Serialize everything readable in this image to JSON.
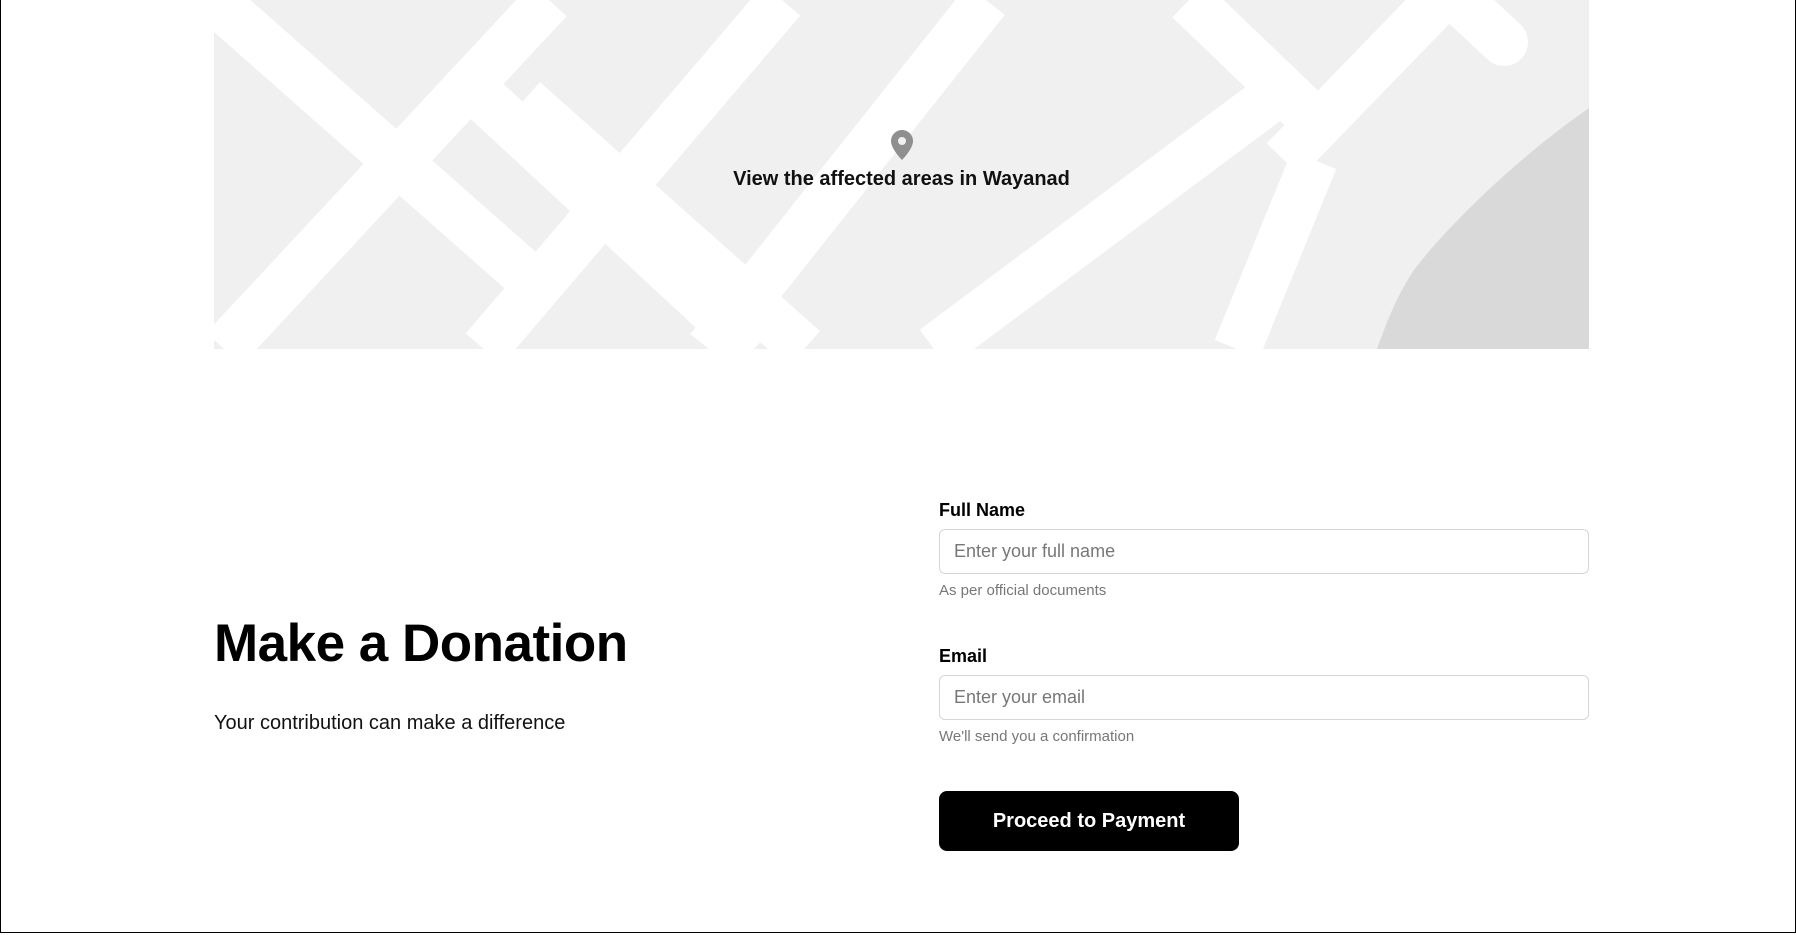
{
  "map": {
    "caption": "View the affected areas in Wayanad",
    "pin_icon": "map-pin-icon"
  },
  "donation": {
    "title": "Make a Donation",
    "subtitle": "Your contribution can make a difference"
  },
  "form": {
    "full_name": {
      "label": "Full Name",
      "placeholder": "Enter your full name",
      "hint": "As per official documents"
    },
    "email": {
      "label": "Email",
      "placeholder": "Enter your email",
      "hint": "We'll send you a confirmation"
    },
    "submit_label": "Proceed to Payment"
  },
  "colors": {
    "map_background": "#f0f0f0",
    "map_roads": "#ffffff",
    "map_water": "#d9d9d9",
    "button_background": "#000000",
    "button_text": "#ffffff"
  }
}
